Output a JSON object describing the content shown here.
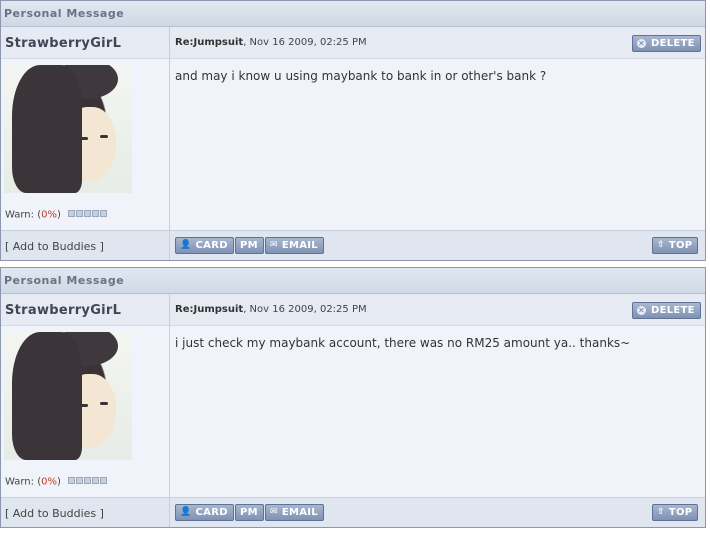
{
  "messages": [
    {
      "section_title": "Personal Message",
      "author": "StrawberryGirL",
      "subject": "Re:Jumpsuit",
      "date": ", Nov 16 2009, 02:25 PM",
      "delete_label": "DELETE",
      "body": "and may i know u using maybank to bank in or other's bank ?",
      "warn_label": "Warn: (",
      "warn_value": "0%",
      "warn_close": ")",
      "add_buddies": "[ Add to Buddies ]",
      "card_label": "CARD",
      "pm_label": "PM",
      "email_label": "EMAIL",
      "top_label": "TOP"
    },
    {
      "section_title": "Personal Message",
      "author": "StrawberryGirL",
      "subject": "Re:Jumpsuit",
      "date": ", Nov 16 2009, 02:25 PM",
      "delete_label": "DELETE",
      "body": "i just check my maybank account, there was no RM25 amount ya.. thanks~",
      "warn_label": "Warn: (",
      "warn_value": "0%",
      "warn_close": ")",
      "add_buddies": "[ Add to Buddies ]",
      "card_label": "CARD",
      "pm_label": "PM",
      "email_label": "EMAIL",
      "top_label": "TOP"
    }
  ],
  "icons": {
    "delete": "close-icon",
    "card": "user-icon",
    "email": "envelope-icon",
    "top": "arrow-up-icon"
  },
  "colors": {
    "button": "#7f92b3",
    "header_bg": "#cfd8e5",
    "panel_bg": "#f0f4fa",
    "warn_value": "#c0392b"
  }
}
